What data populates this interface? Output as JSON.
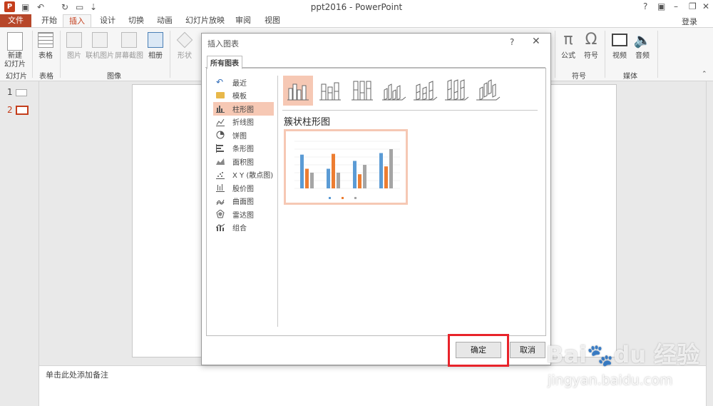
{
  "window": {
    "title": "ppt2016 - PowerPoint",
    "help": "?"
  },
  "tabs": [
    "文件",
    "开始",
    "插入",
    "设计",
    "切换",
    "动画",
    "幻灯片放映",
    "审阅",
    "视图"
  ],
  "active_tab": "插入",
  "login": "登录",
  "ribbon": {
    "new_slide": "新建\n幻灯片",
    "table": "表格",
    "picture": "图片",
    "online_picture": "联机图片",
    "screenshot": "屏幕截图",
    "album": "相册",
    "shape": "形状",
    "formula": "公式",
    "symbol": "符号",
    "video": "视频",
    "audio": "音频",
    "groups": {
      "slides": "幻灯片",
      "tables": "表格",
      "images": "图像",
      "symbols": "符号",
      "media": "媒体"
    }
  },
  "thumbnails": [
    {
      "num": "1"
    },
    {
      "num": "2"
    }
  ],
  "notes_placeholder": "单击此处添加备注",
  "dialog": {
    "title": "插入图表",
    "tab": "所有图表",
    "chart_types": [
      "最近",
      "模板",
      "柱形图",
      "折线图",
      "饼图",
      "条形图",
      "面积图",
      "X Y (散点图)",
      "股价图",
      "曲面图",
      "雷达图",
      "组合"
    ],
    "selected_type": "柱形图",
    "selected_subtype": "簇状柱形图",
    "ok": "确定",
    "cancel": "取消"
  },
  "preview_chart": {
    "colors": [
      "#5b9bd5",
      "#ed7d31",
      "#a5a5a5"
    ]
  },
  "watermark": {
    "brand": "Bai du 经验",
    "url": "jingyan.baidu.com"
  },
  "highlight_color": "#e8232a"
}
